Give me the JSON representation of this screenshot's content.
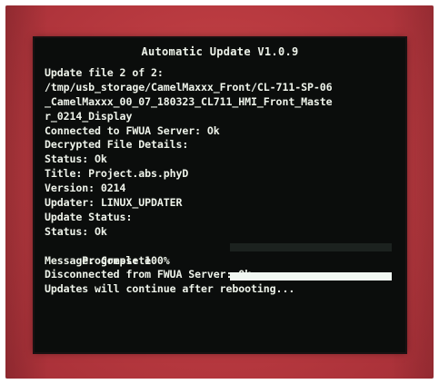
{
  "window": {
    "title": "Automatic Update V1.0.9"
  },
  "log": {
    "update_file": "Update file 2 of 2:",
    "path_line1": "/tmp/usb_storage/CamelMaxxx_Front/CL-711-SP-06",
    "path_line2": "_CamelMaxxx_00_07_180323_CL711_HMI_Front_Maste",
    "path_line3": "r_0214_Display",
    "connected": "Connected to FWUA Server: Ok",
    "decrypted": "Decrypted File Details:",
    "status1": "Status: Ok",
    "title_line": "Title: Project.abs.phyD",
    "version": "Version: 0214",
    "updater": "Updater: LINUX_UPDATER",
    "update_status": "Update Status:",
    "status2": "Status: Ok",
    "progress_label": "Progress: 100%",
    "message": "Message: Complete",
    "disconnected": "Disconnected from FWUA Server: Ok",
    "continue": "Updates will continue after rebooting..."
  },
  "progress": {
    "value_percent": 100,
    "fill_color": "#f1f7f2"
  },
  "colors": {
    "frame": "#b93a40",
    "screen": "#0b0d0c",
    "text": "#eef3ea"
  }
}
